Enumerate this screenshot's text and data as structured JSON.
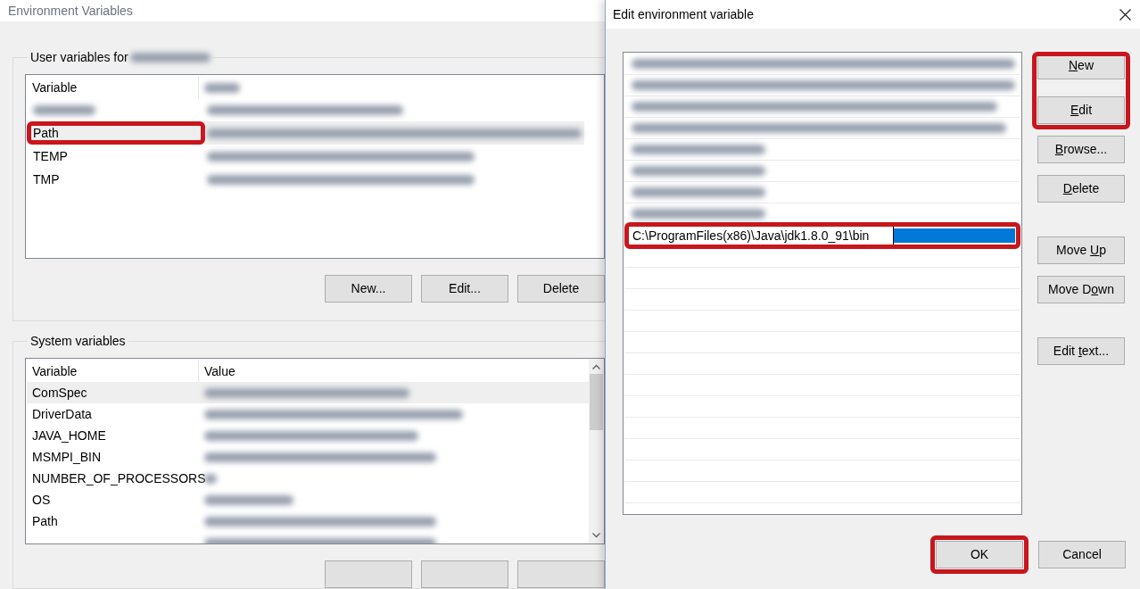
{
  "main_window": {
    "title": "Environment Variables",
    "user_variables": {
      "label": "User variables for",
      "columns": [
        "Variable"
      ],
      "rows": [
        {
          "selected": false,
          "highlighted": false
        },
        {
          "variable": "Path",
          "selected": true,
          "highlighted": true
        },
        {
          "variable": "TEMP",
          "selected": false,
          "highlighted": false
        },
        {
          "variable": "TMP",
          "selected": false,
          "highlighted": false
        }
      ],
      "buttons": [
        "New...",
        "Edit...",
        "Delete"
      ]
    },
    "system_variables": {
      "label": "System variables",
      "columns": [
        "Variable",
        "Value"
      ],
      "rows": [
        {
          "variable": "ComSpec",
          "selected": true
        },
        {
          "variable": "DriverData",
          "selected": false
        },
        {
          "variable": "JAVA_HOME",
          "selected": false
        },
        {
          "variable": "MSMPI_BIN",
          "selected": false
        },
        {
          "variable": "NUMBER_OF_PROCESSORS",
          "selected": false
        },
        {
          "variable": "OS",
          "selected": false
        },
        {
          "variable": "Path",
          "selected": false
        },
        {
          "selected": false
        }
      ]
    }
  },
  "edit_dialog": {
    "title": "Edit environment variable",
    "entries": [
      {
        "kind": "blurred"
      },
      {
        "kind": "blurred"
      },
      {
        "kind": "blurred"
      },
      {
        "kind": "blurred"
      },
      {
        "kind": "blurred"
      },
      {
        "kind": "blurred"
      },
      {
        "kind": "blurred"
      },
      {
        "kind": "blurred"
      },
      {
        "kind": "editing",
        "value": "C:\\ProgramFiles(x86)\\Java\\jdk1.8.0_91\\bin",
        "highlighted": true
      }
    ],
    "buttons": [
      {
        "access_key": "N",
        "label_rest": "ew",
        "highlighted": true
      },
      {
        "access_key": "E",
        "label_rest": "dit",
        "highlighted": true
      },
      {
        "access_key": "B",
        "label_rest": "rowse...",
        "highlighted": false
      },
      {
        "access_key": "D",
        "label_rest": "elete",
        "highlighted": false
      },
      {
        "label_before": "Move ",
        "access_key": "U",
        "label_rest": "p",
        "highlighted": false
      },
      {
        "label_before": "Move D",
        "access_key": "o",
        "label_rest": "wn",
        "highlighted": false
      },
      {
        "label_before": "Edit ",
        "access_key": "t",
        "label_rest": "ext...",
        "highlighted": false
      }
    ],
    "footer_buttons": [
      {
        "label": "OK",
        "highlighted": true
      },
      {
        "label": "Cancel",
        "highlighted": false
      }
    ]
  }
}
